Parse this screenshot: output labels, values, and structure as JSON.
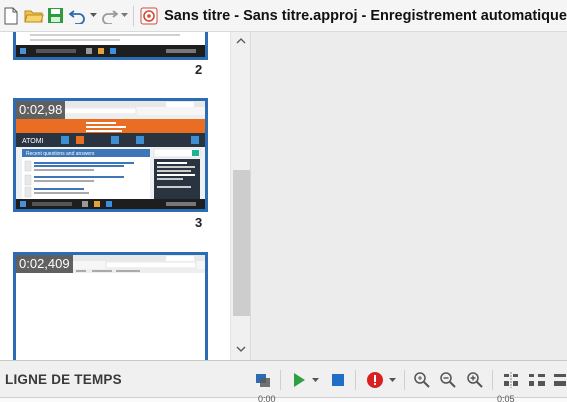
{
  "toolbar": {
    "icons": [
      "new-file-icon",
      "open-folder-icon",
      "save-icon",
      "undo-icon",
      "redo-icon",
      "app-logo-icon"
    ]
  },
  "window": {
    "title": "Sans titre - Sans titre.approj - Enregistrement automatique"
  },
  "slides": [
    {
      "number": "2",
      "time": ""
    },
    {
      "number": "3",
      "time": "0:02,98"
    },
    {
      "number": "",
      "time": "0:02,409"
    }
  ],
  "thumbnail_content": {
    "banner_text": "Recent questions and answers",
    "brand": "ATOMI"
  },
  "timeline": {
    "label": "LIGNE DE TEMPS",
    "ruler_start": "0:00",
    "ruler_end": "0:05"
  },
  "colors": {
    "slide_border": "#2b6cb3",
    "play": "#2ea043",
    "stop": "#1f6fc4",
    "record": "#d92121",
    "banner_orange": "#e96d22"
  }
}
